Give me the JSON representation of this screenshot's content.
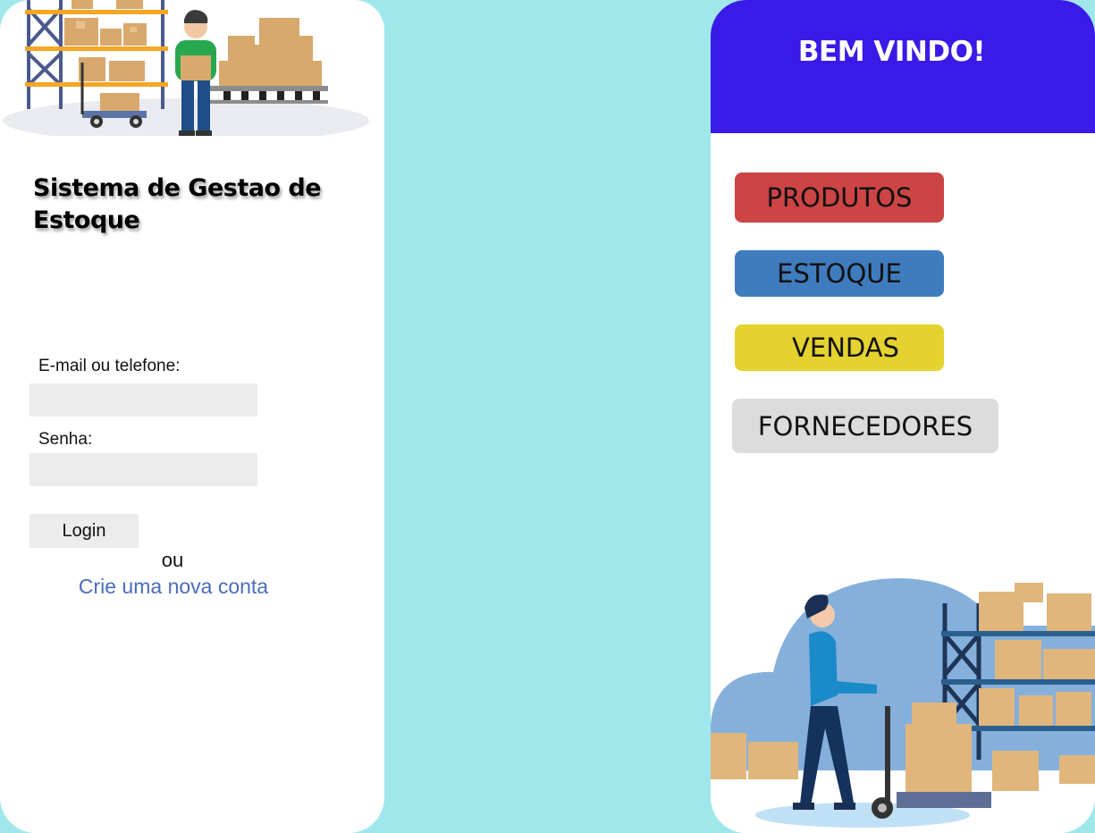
{
  "login": {
    "title": "Sistema de Gestao de Estoque",
    "email_label": "E-mail ou telefone:",
    "email_value": "",
    "password_label": "Senha:",
    "password_value": "",
    "login_button": "Login",
    "or_text": "ou",
    "create_account_link": "Crie uma nova conta"
  },
  "menu": {
    "title": "BEM VINDO!",
    "buttons": [
      {
        "label": "PRODUTOS",
        "color": "#cc4444"
      },
      {
        "label": "ESTOQUE",
        "color": "#3f7cbe"
      },
      {
        "label": "VENDAS",
        "color": "#e4d22e"
      },
      {
        "label": "FORNECEDORES",
        "color": "#dcdcdc"
      }
    ]
  },
  "colors": {
    "background": "#a0e7ec",
    "header": "#3a1ae6",
    "link": "#4a6cbc",
    "input_bg": "#ececec"
  },
  "icons": {
    "top_illustration": "warehouse-worker-illustration",
    "bottom_illustration": "pallet-jack-worker-illustration"
  }
}
